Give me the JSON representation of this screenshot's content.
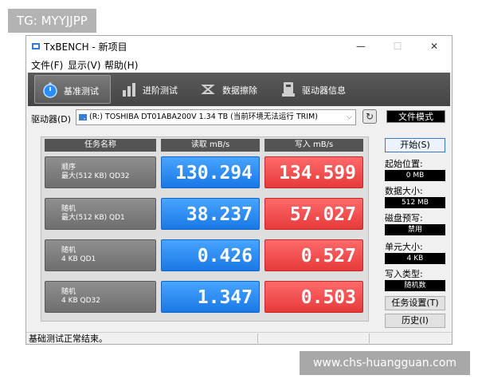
{
  "watermarks": {
    "top_left": "TG: MYYJJPP",
    "bottom_right": "www.chs-huangguan.com"
  },
  "window": {
    "title": "TxBENCH - 新项目",
    "controls": {
      "minimize": "—",
      "maximize": "☐",
      "close": "✕"
    }
  },
  "menu": {
    "items": [
      {
        "label": "文件(F)"
      },
      {
        "label": "显示(V)"
      },
      {
        "label": "帮助(H)"
      }
    ]
  },
  "toolbar": {
    "tabs": [
      {
        "label": "基准测试",
        "icon": "stopwatch-icon",
        "active": true
      },
      {
        "label": "进阶测试",
        "icon": "bar-chart-icon",
        "active": false
      },
      {
        "label": "数据擦除",
        "icon": "erase-icon",
        "active": false
      },
      {
        "label": "驱动器信息",
        "icon": "drive-info-icon",
        "active": false
      }
    ]
  },
  "drive": {
    "label": "驱动器(D)",
    "selected": "(R:) TOSHIBA DT01ABA200V  1.34 TB (当前环境无法运行 TRIM)",
    "mode_button": "文件模式"
  },
  "table": {
    "headers": {
      "task": "任务名称",
      "read": "读取 mB/s",
      "write": "写入 mB/s"
    },
    "rows": [
      {
        "line1": "顺序",
        "line2": "最大(512 KB) QD32",
        "read": "130.294",
        "write": "134.599"
      },
      {
        "line1": "随机",
        "line2": "最大(512 KB) QD1",
        "read": "38.237",
        "write": "57.027"
      },
      {
        "line1": "随机",
        "line2": "4 KB QD1",
        "read": "0.426",
        "write": "0.527"
      },
      {
        "line1": "随机",
        "line2": "4 KB QD32",
        "read": "1.347",
        "write": "0.503"
      }
    ]
  },
  "side": {
    "start_button": "开始(S)",
    "start_pos_label": "起始位置:",
    "start_pos_value": "0 MB",
    "data_size_label": "数据大小:",
    "data_size_value": "512 MB",
    "precond_label": "磁盘预写:",
    "precond_value": "禁用",
    "unit_label": "单元大小:",
    "unit_value": "4 KB",
    "write_type_label": "写入类型:",
    "write_type_value": "随机数",
    "task_settings_button": "任务设置(T)",
    "history_button": "历史(I)"
  },
  "status": {
    "text": "基础测试正常结束。"
  },
  "colors": {
    "read_cell": "#2b8af0",
    "write_cell": "#f04a4a",
    "toolbar": "#4f4f4f",
    "task_cell": "#7a7a7a"
  }
}
